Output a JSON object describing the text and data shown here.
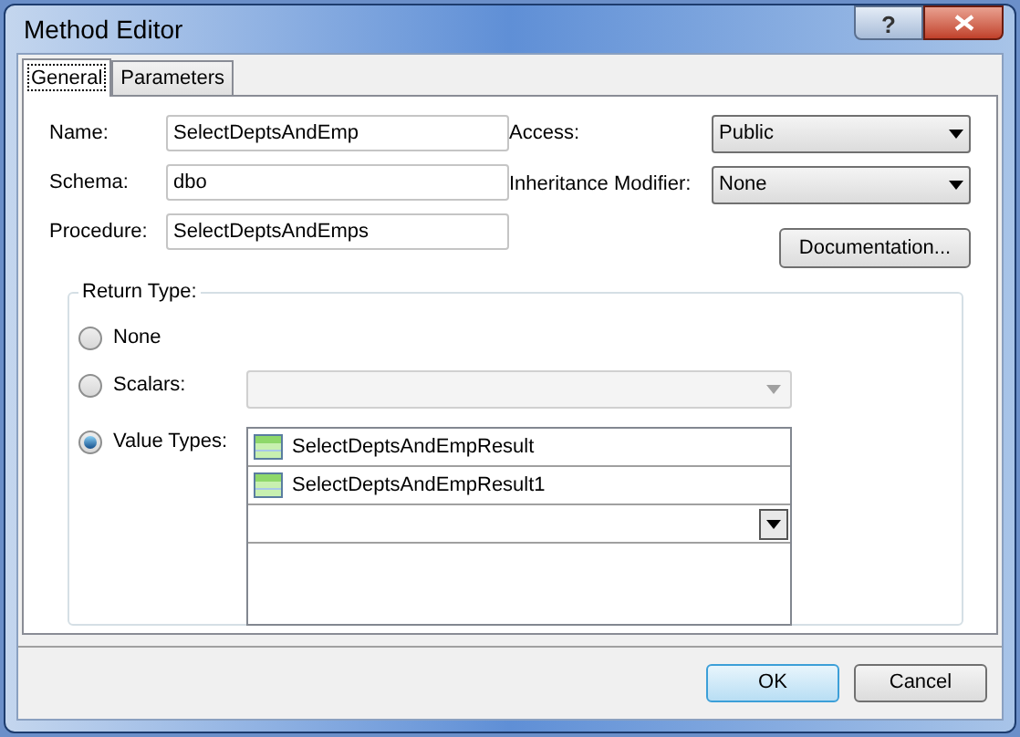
{
  "window": {
    "title": "Method Editor",
    "help": "?"
  },
  "tabs": [
    {
      "label": "General",
      "selected": true
    },
    {
      "label": "Parameters",
      "selected": false
    }
  ],
  "fields": [
    {
      "label": "Name:",
      "value": "SelectDeptsAndEmp"
    },
    {
      "label": "Schema:",
      "value": "dbo"
    },
    {
      "label": "Procedure:",
      "value": "SelectDeptsAndEmps"
    }
  ],
  "dropdowns": [
    {
      "label": "Access:",
      "value": "Public"
    },
    {
      "label": "Inheritance Modifier:",
      "value": "None"
    }
  ],
  "documentation_button": {
    "label": "Documentation..."
  },
  "return_type": {
    "title": "Return Type:",
    "options": [
      {
        "kind": "plain",
        "label": "None",
        "selected": false
      },
      {
        "kind": "combo",
        "label": "Scalars:",
        "selected": false,
        "disabled": true
      },
      {
        "kind": "list",
        "label": "Value Types:",
        "selected": true,
        "items": [
          "SelectDeptsAndEmpResult",
          "SelectDeptsAndEmpResult1"
        ]
      }
    ]
  },
  "buttons": [
    {
      "label": "OK",
      "default": true
    },
    {
      "label": "Cancel",
      "default": false
    }
  ]
}
